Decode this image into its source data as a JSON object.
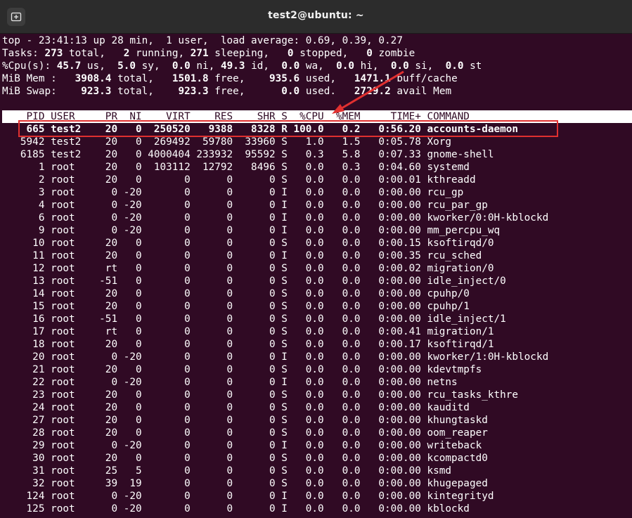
{
  "window": {
    "title": "test2@ubuntu: ~"
  },
  "summary": {
    "uptime_line": "top - 23:41:13 up 28 min,  1 user,  load average: 0.69, 0.39, 0.27",
    "tasks": {
      "label": "Tasks:",
      "total": "273",
      "running": "2",
      "sleeping": "271",
      "stopped": "0",
      "zombie": "0"
    },
    "cpu": {
      "label": "%Cpu(s):",
      "us": "45.7",
      "sy": "5.0",
      "ni": "0.0",
      "id": "49.3",
      "wa": "0.0",
      "hi": "0.0",
      "si": "0.0",
      "st": "0.0"
    },
    "mem": {
      "label": "MiB Mem :",
      "total": "3908.4",
      "free": "1501.8",
      "used": "935.6",
      "buff_cache": "1471.1"
    },
    "swap": {
      "label": "MiB Swap:",
      "total": "923.3",
      "free": "923.3",
      "used": "0.0",
      "avail": "2729.2"
    }
  },
  "columns": [
    "PID",
    "USER",
    "PR",
    "NI",
    "VIRT",
    "RES",
    "SHR",
    "S",
    "%CPU",
    "%MEM",
    "TIME+",
    "COMMAND"
  ],
  "processes": [
    [
      "665",
      "test2",
      "20",
      "0",
      "250520",
      "9388",
      "8328",
      "R",
      "100.0",
      "0.2",
      "0:56.20",
      "accounts-daemon"
    ],
    [
      "5942",
      "test2",
      "20",
      "0",
      "269492",
      "59780",
      "33960",
      "S",
      "1.0",
      "1.5",
      "0:05.78",
      "Xorg"
    ],
    [
      "6185",
      "test2",
      "20",
      "0",
      "4000404",
      "233932",
      "95592",
      "S",
      "0.3",
      "5.8",
      "0:07.33",
      "gnome-shell"
    ],
    [
      "1",
      "root",
      "20",
      "0",
      "103112",
      "12792",
      "8496",
      "S",
      "0.0",
      "0.3",
      "0:04.60",
      "systemd"
    ],
    [
      "2",
      "root",
      "20",
      "0",
      "0",
      "0",
      "0",
      "S",
      "0.0",
      "0.0",
      "0:00.01",
      "kthreadd"
    ],
    [
      "3",
      "root",
      "0",
      "-20",
      "0",
      "0",
      "0",
      "I",
      "0.0",
      "0.0",
      "0:00.00",
      "rcu_gp"
    ],
    [
      "4",
      "root",
      "0",
      "-20",
      "0",
      "0",
      "0",
      "I",
      "0.0",
      "0.0",
      "0:00.00",
      "rcu_par_gp"
    ],
    [
      "6",
      "root",
      "0",
      "-20",
      "0",
      "0",
      "0",
      "I",
      "0.0",
      "0.0",
      "0:00.00",
      "kworker/0:0H-kblockd"
    ],
    [
      "9",
      "root",
      "0",
      "-20",
      "0",
      "0",
      "0",
      "I",
      "0.0",
      "0.0",
      "0:00.00",
      "mm_percpu_wq"
    ],
    [
      "10",
      "root",
      "20",
      "0",
      "0",
      "0",
      "0",
      "S",
      "0.0",
      "0.0",
      "0:00.15",
      "ksoftirqd/0"
    ],
    [
      "11",
      "root",
      "20",
      "0",
      "0",
      "0",
      "0",
      "I",
      "0.0",
      "0.0",
      "0:00.35",
      "rcu_sched"
    ],
    [
      "12",
      "root",
      "rt",
      "0",
      "0",
      "0",
      "0",
      "S",
      "0.0",
      "0.0",
      "0:00.02",
      "migration/0"
    ],
    [
      "13",
      "root",
      "-51",
      "0",
      "0",
      "0",
      "0",
      "S",
      "0.0",
      "0.0",
      "0:00.00",
      "idle_inject/0"
    ],
    [
      "14",
      "root",
      "20",
      "0",
      "0",
      "0",
      "0",
      "S",
      "0.0",
      "0.0",
      "0:00.00",
      "cpuhp/0"
    ],
    [
      "15",
      "root",
      "20",
      "0",
      "0",
      "0",
      "0",
      "S",
      "0.0",
      "0.0",
      "0:00.00",
      "cpuhp/1"
    ],
    [
      "16",
      "root",
      "-51",
      "0",
      "0",
      "0",
      "0",
      "S",
      "0.0",
      "0.0",
      "0:00.00",
      "idle_inject/1"
    ],
    [
      "17",
      "root",
      "rt",
      "0",
      "0",
      "0",
      "0",
      "S",
      "0.0",
      "0.0",
      "0:00.41",
      "migration/1"
    ],
    [
      "18",
      "root",
      "20",
      "0",
      "0",
      "0",
      "0",
      "S",
      "0.0",
      "0.0",
      "0:00.17",
      "ksoftirqd/1"
    ],
    [
      "20",
      "root",
      "0",
      "-20",
      "0",
      "0",
      "0",
      "I",
      "0.0",
      "0.0",
      "0:00.00",
      "kworker/1:0H-kblockd"
    ],
    [
      "21",
      "root",
      "20",
      "0",
      "0",
      "0",
      "0",
      "S",
      "0.0",
      "0.0",
      "0:00.00",
      "kdevtmpfs"
    ],
    [
      "22",
      "root",
      "0",
      "-20",
      "0",
      "0",
      "0",
      "I",
      "0.0",
      "0.0",
      "0:00.00",
      "netns"
    ],
    [
      "23",
      "root",
      "20",
      "0",
      "0",
      "0",
      "0",
      "S",
      "0.0",
      "0.0",
      "0:00.00",
      "rcu_tasks_kthre"
    ],
    [
      "24",
      "root",
      "20",
      "0",
      "0",
      "0",
      "0",
      "S",
      "0.0",
      "0.0",
      "0:00.00",
      "kauditd"
    ],
    [
      "27",
      "root",
      "20",
      "0",
      "0",
      "0",
      "0",
      "S",
      "0.0",
      "0.0",
      "0:00.00",
      "khungtaskd"
    ],
    [
      "28",
      "root",
      "20",
      "0",
      "0",
      "0",
      "0",
      "S",
      "0.0",
      "0.0",
      "0:00.00",
      "oom_reaper"
    ],
    [
      "29",
      "root",
      "0",
      "-20",
      "0",
      "0",
      "0",
      "I",
      "0.0",
      "0.0",
      "0:00.00",
      "writeback"
    ],
    [
      "30",
      "root",
      "20",
      "0",
      "0",
      "0",
      "0",
      "S",
      "0.0",
      "0.0",
      "0:00.00",
      "kcompactd0"
    ],
    [
      "31",
      "root",
      "25",
      "5",
      "0",
      "0",
      "0",
      "S",
      "0.0",
      "0.0",
      "0:00.00",
      "ksmd"
    ],
    [
      "32",
      "root",
      "39",
      "19",
      "0",
      "0",
      "0",
      "S",
      "0.0",
      "0.0",
      "0:00.00",
      "khugepaged"
    ],
    [
      "124",
      "root",
      "0",
      "-20",
      "0",
      "0",
      "0",
      "I",
      "0.0",
      "0.0",
      "0:00.00",
      "kintegrityd"
    ],
    [
      "125",
      "root",
      "0",
      "-20",
      "0",
      "0",
      "0",
      "I",
      "0.0",
      "0.0",
      "0:00.00",
      "kblockd"
    ]
  ],
  "colors": {
    "terminal_bg": "#300a24",
    "text": "#ffffff",
    "titlebar_bg": "#2c2c2c",
    "annotation_red": "#e03030"
  },
  "icons": {
    "new_tab": "new-tab-icon"
  }
}
